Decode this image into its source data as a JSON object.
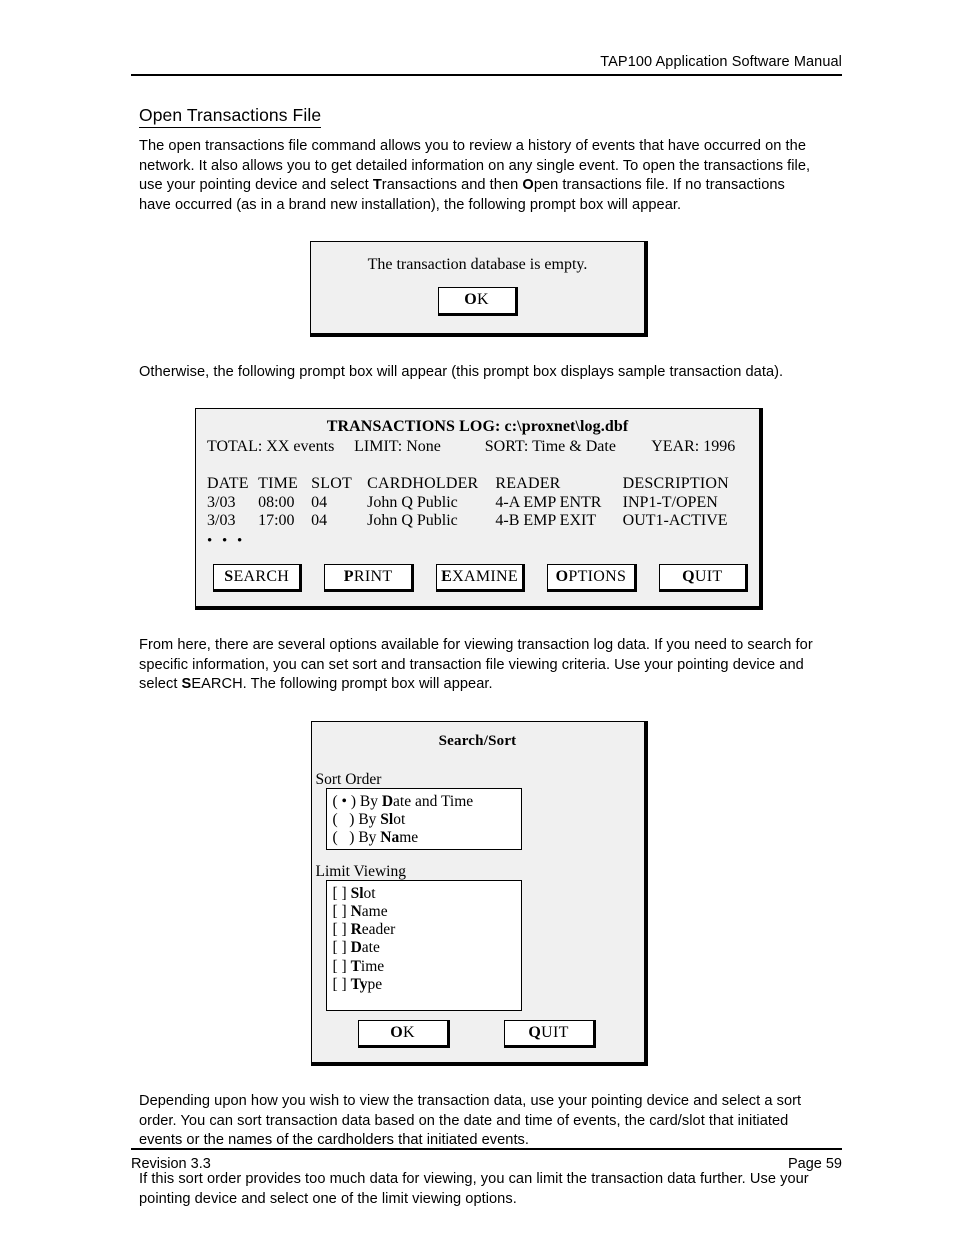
{
  "header": {
    "title": "TAP100 Application Software Manual"
  },
  "footer": {
    "revision": "Revision 3.3",
    "page": "Page 59"
  },
  "section": {
    "title": "Open Transactions File"
  },
  "paragraphs": {
    "intro_1": "The open transactions file command allows you to review a history of events that have occurred on the network. It also allows you to get detailed information on any single event. To open the transactions file, use your pointing device and select ",
    "intro_accel_t": "T",
    "intro_2": "ransactions and then ",
    "intro_accel_o": "O",
    "intro_3": "pen transactions file. If no transactions have occurred (as in a brand new installation), the following prompt box will appear.",
    "otherwise": "Otherwise, the following prompt box will appear (this prompt box displays sample transaction data).",
    "from_here_1": "From here, there are several options available for viewing transaction log data. If you need to search for specific information, you can set sort and transaction file viewing criteria. Use your pointing device and select ",
    "from_here_accel_s": "S",
    "from_here_2": "EARCH. The following prompt box will appear.",
    "depending": "Depending upon how you wish to view the transaction data, use your pointing device and select a sort order. You can sort transaction data based on the date and time of events, the card/slot that initiated events or the names of the cardholders that initiated events.",
    "if_this": "If this sort order provides too much data for viewing, you can limit the transaction data further. Use your pointing device and select one of the limit viewing options."
  },
  "empty_dialog": {
    "message": "The transaction database is empty.",
    "ok_accel": "O",
    "ok_rest": "K"
  },
  "log_dialog": {
    "title": "TRANSACTIONS LOG: c:\\proxnet\\log.dbf",
    "summary": {
      "total": "TOTAL: XX events",
      "limit": "LIMIT: None",
      "sort": "SORT: Time & Date",
      "year": "YEAR: 1996"
    },
    "columns": [
      "DATE",
      "TIME",
      "SLOT",
      "CARDHOLDER",
      "READER",
      "DESCRIPTION"
    ],
    "rows": [
      [
        "3/03",
        "08:00",
        "04",
        "John Q Public",
        "4-A EMP ENTR",
        "INP1-T/OPEN"
      ],
      [
        "3/03",
        "17:00",
        "04",
        "John Q Public",
        "4-B EMP EXIT",
        "OUT1-ACTIVE"
      ]
    ],
    "ellipsis": "• • •",
    "buttons": [
      {
        "accel": "S",
        "rest": "EARCH"
      },
      {
        "accel": "P",
        "rest": "RINT"
      },
      {
        "accel": "E",
        "rest": "XAMINE"
      },
      {
        "accel": "O",
        "rest": "PTIONS"
      },
      {
        "accel": "Q",
        "rest": "UIT"
      }
    ]
  },
  "search_dialog": {
    "title": "Search/Sort",
    "sort_order_label": "Sort Order",
    "sort_options": [
      {
        "marker": "( • ) ",
        "prefix": "By ",
        "accel": "D",
        "suffix": "ate and Time"
      },
      {
        "marker": "(   ) ",
        "prefix": "By ",
        "accel": "Sl",
        "suffix": "ot"
      },
      {
        "marker": "(   ) ",
        "prefix": "By ",
        "accel": "Na",
        "suffix": "me"
      }
    ],
    "limit_viewing_label": "Limit Viewing",
    "limit_options": [
      {
        "marker": "[ ] ",
        "accel": "Sl",
        "suffix": "ot"
      },
      {
        "marker": "[ ] ",
        "accel": "N",
        "suffix": "ame"
      },
      {
        "marker": "[ ] ",
        "accel": "R",
        "suffix": "eader"
      },
      {
        "marker": "[ ] ",
        "accel": "D",
        "suffix": "ate"
      },
      {
        "marker": "[ ] ",
        "accel": "T",
        "suffix": "ime"
      },
      {
        "marker": "[ ] ",
        "accel": "Ty",
        "suffix": "pe"
      }
    ],
    "ok": {
      "accel": "O",
      "rest": "K"
    },
    "quit": {
      "accel": "Q",
      "rest": "UIT"
    }
  }
}
